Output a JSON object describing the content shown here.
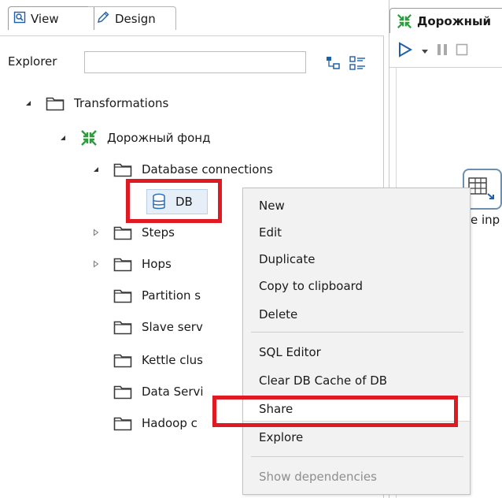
{
  "tabs": {
    "view_label": "View",
    "design_label": "Design"
  },
  "explorer": {
    "label": "Explorer",
    "search_value": ""
  },
  "tree": {
    "transformations": "Transformations",
    "transformation_name": "Дорожный фонд",
    "database_connections": "Database connections",
    "db_item": "DB",
    "steps": "Steps",
    "hops": "Hops",
    "partition": "Partition s",
    "slave": "Slave serv",
    "kettle": "Kettle clus",
    "data_services": "Data Servi",
    "hadoop": "Hadoop c"
  },
  "right_panel": {
    "tab_title": "Дорожный",
    "step_label_partial": "e inp"
  },
  "context_menu": {
    "items": [
      {
        "label": "New",
        "disabled": false
      },
      {
        "label": "Edit",
        "disabled": false
      },
      {
        "label": "Duplicate",
        "disabled": false
      },
      {
        "label": "Copy to clipboard",
        "disabled": false
      },
      {
        "label": "Delete",
        "disabled": false
      },
      {
        "label": "SQL Editor",
        "disabled": false
      },
      {
        "label": "Clear DB Cache of DB",
        "disabled": false
      },
      {
        "label": "Share",
        "disabled": false
      },
      {
        "label": "Explore",
        "disabled": false
      },
      {
        "label": "Show dependencies",
        "disabled": true
      }
    ]
  },
  "colors": {
    "highlight": "#e01a22",
    "folder_stroke": "#3a3a3a",
    "transformation_icon": "#2e9b3e",
    "db_icon_stroke": "#2a6fb5",
    "play_icon": "#1f5ea8"
  },
  "icons": {
    "view_tab": "view-tab-icon",
    "design_tab": "pencil-icon",
    "collapse_all": "collapse-all-icon",
    "show_list": "list-icon",
    "folder": "folder-icon",
    "transformation": "transformation-icon",
    "database": "database-icon",
    "run": "play-icon",
    "pause": "pause-icon",
    "stop": "stop-icon"
  }
}
